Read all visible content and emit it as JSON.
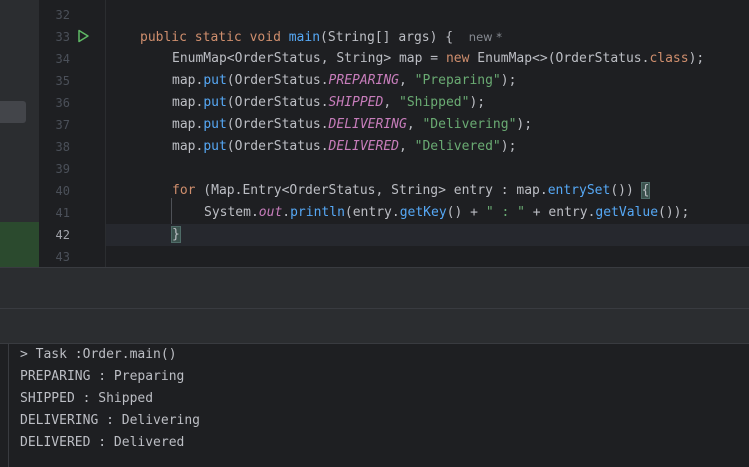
{
  "gutter": {
    "line_numbers": [
      "32",
      "33",
      "34",
      "35",
      "36",
      "37",
      "38",
      "39",
      "40",
      "41",
      "42",
      "43"
    ],
    "current_line": "42"
  },
  "code": {
    "main_decl": {
      "public": "public",
      "static": "static",
      "void": "void",
      "name": "main",
      "paren_open": "(",
      "param_type": "String[]",
      "param_name": "args",
      "rest": ") {",
      "hint": "new *"
    },
    "line34": {
      "type1": "EnumMap<OrderStatus, String>",
      "var": " map = ",
      "new": "new",
      "type2": " EnumMap<>(OrderStatus.",
      "cls": "class",
      "end": ");"
    },
    "puts": [
      {
        "prefix": "map.",
        "fn": "put",
        "mid": "(OrderStatus.",
        "const": "PREPARING",
        "sep": ", ",
        "str": "\"Preparing\"",
        "end": ");"
      },
      {
        "prefix": "map.",
        "fn": "put",
        "mid": "(OrderStatus.",
        "const": "SHIPPED",
        "sep": ", ",
        "str": "\"Shipped\"",
        "end": ");"
      },
      {
        "prefix": "map.",
        "fn": "put",
        "mid": "(OrderStatus.",
        "const": "DELIVERING",
        "sep": ", ",
        "str": "\"Delivering\"",
        "end": ");"
      },
      {
        "prefix": "map.",
        "fn": "put",
        "mid": "(OrderStatus.",
        "const": "DELIVERED",
        "sep": ", ",
        "str": "\"Delivered\"",
        "end": ");"
      }
    ],
    "line40": {
      "for": "for",
      "a": " (Map.Entry<OrderStatus, String> entry : map.",
      "fn": "entrySet",
      "b": "()) ",
      "brace": "{"
    },
    "line41": {
      "a": "System.",
      "out": "out",
      "b": ".",
      "println": "println",
      "c": "(entry.",
      "getKey": "getKey",
      "d": "() + ",
      "str": "\" : \"",
      "e": " + entry.",
      "getValue": "getValue",
      "f": "());"
    },
    "line42": {
      "brace": "}"
    }
  },
  "console": {
    "lines": [
      "> Task :Order.main()",
      "PREPARING : Preparing",
      "SHIPPED : Shipped",
      "DELIVERING : Delivering",
      "DELIVERED : Delivered"
    ]
  },
  "icons": {
    "run": "run-gutter-icon",
    "bulb": "intention-bulb-icon"
  },
  "colors": {
    "keyword": "#cf8e6d",
    "function": "#56a8f5",
    "string": "#6aab73",
    "constant": "#c77dbb",
    "background": "#1e1f22"
  }
}
